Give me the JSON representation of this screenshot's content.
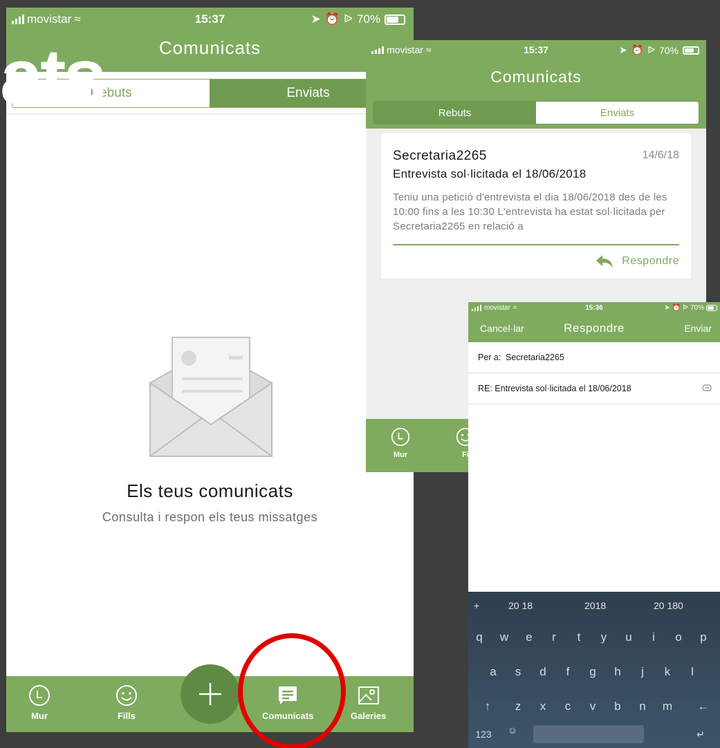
{
  "overlay_text": "ats",
  "colors": {
    "accent": "#7fab5e",
    "accent_dark": "#6f9b51",
    "fab": "#5f8a44",
    "highlight": "#e00000"
  },
  "phone1": {
    "status": {
      "carrier": "movistar",
      "time": "15:37",
      "battery": "70%"
    },
    "title": "Comunicats",
    "tabs": {
      "received": "Rebuts",
      "sent": "Enviats"
    },
    "empty_state": {
      "title": "Els teus comunicats",
      "subtitle": "Consulta i respon els teus missatges"
    },
    "tabbar": {
      "mur": "Mur",
      "fills": "Fills",
      "comunicats": "Comunicats",
      "galeries": "Galeries"
    }
  },
  "phone2": {
    "status": {
      "carrier": "movistar",
      "time": "15:37",
      "battery": "70%"
    },
    "title": "Comunicats",
    "tabs": {
      "received": "Rebuts",
      "sent": "Enviats"
    },
    "message": {
      "sender": "Secretaria2265",
      "date": "14/6/18",
      "subject": "Entrevista sol·licitada el 18/06/2018",
      "body": "Teniu una petició d'entrevista el dia 18/06/2018 des de les 10:00 fins a les 10:30 L'entrevista ha estat sol·licitada per Secretaria2265 en relació a",
      "reply_label": "Respondre"
    },
    "tabbar": {
      "mur": "Mur",
      "fills": "Fi"
    }
  },
  "phone3": {
    "status": {
      "carrier": "movistar",
      "time": "15:36",
      "battery": "70%"
    },
    "cancel": "Cancel·lar",
    "title": "Respondre",
    "send": "Enviar",
    "to_label": "Per a:",
    "to_value": "Secretaria2265",
    "subject": "RE: Entrevista sol·licitada el 18/06/2018",
    "keyboard": {
      "plus": "+",
      "suggestions": [
        "20 18",
        "2018",
        "20 180"
      ],
      "row1": [
        "q",
        "w",
        "e",
        "r",
        "t",
        "y",
        "u",
        "i",
        "o",
        "p"
      ],
      "row2": [
        "a",
        "s",
        "d",
        "f",
        "g",
        "h",
        "j",
        "k",
        "l"
      ],
      "row3": [
        "↑",
        "z",
        "x",
        "c",
        "v",
        "b",
        "n",
        "m",
        "←"
      ],
      "numbers": "123",
      "enter": "↵"
    }
  }
}
